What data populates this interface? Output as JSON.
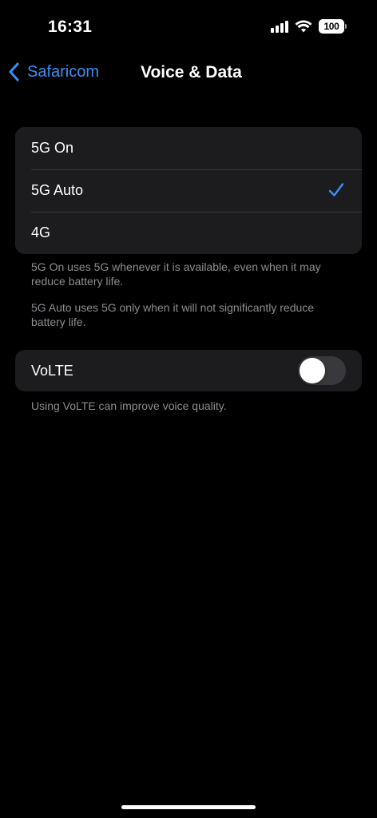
{
  "status_bar": {
    "time": "16:31",
    "battery": "100"
  },
  "nav": {
    "back_label": "Safaricom",
    "title": "Voice & Data"
  },
  "network_options": [
    {
      "label": "5G On",
      "selected": false
    },
    {
      "label": "5G Auto",
      "selected": true
    },
    {
      "label": "4G",
      "selected": false
    }
  ],
  "footnotes": {
    "five_g_on": "5G On uses 5G whenever it is available, even when it may reduce battery life.",
    "five_g_auto": "5G Auto uses 5G only when it will not significantly reduce battery life.",
    "volte": "Using VoLTE can improve voice quality."
  },
  "volte": {
    "label": "VoLTE",
    "enabled": false
  },
  "colors": {
    "accent": "#3b8ff6",
    "background": "#000000",
    "cell": "#1c1c1e",
    "secondary_text": "#8d8d93"
  },
  "icons": {
    "back": "chevron-left-icon",
    "selected": "checkmark-icon",
    "signal": "cellular-signal-icon",
    "wifi": "wifi-icon",
    "battery": "battery-icon"
  }
}
